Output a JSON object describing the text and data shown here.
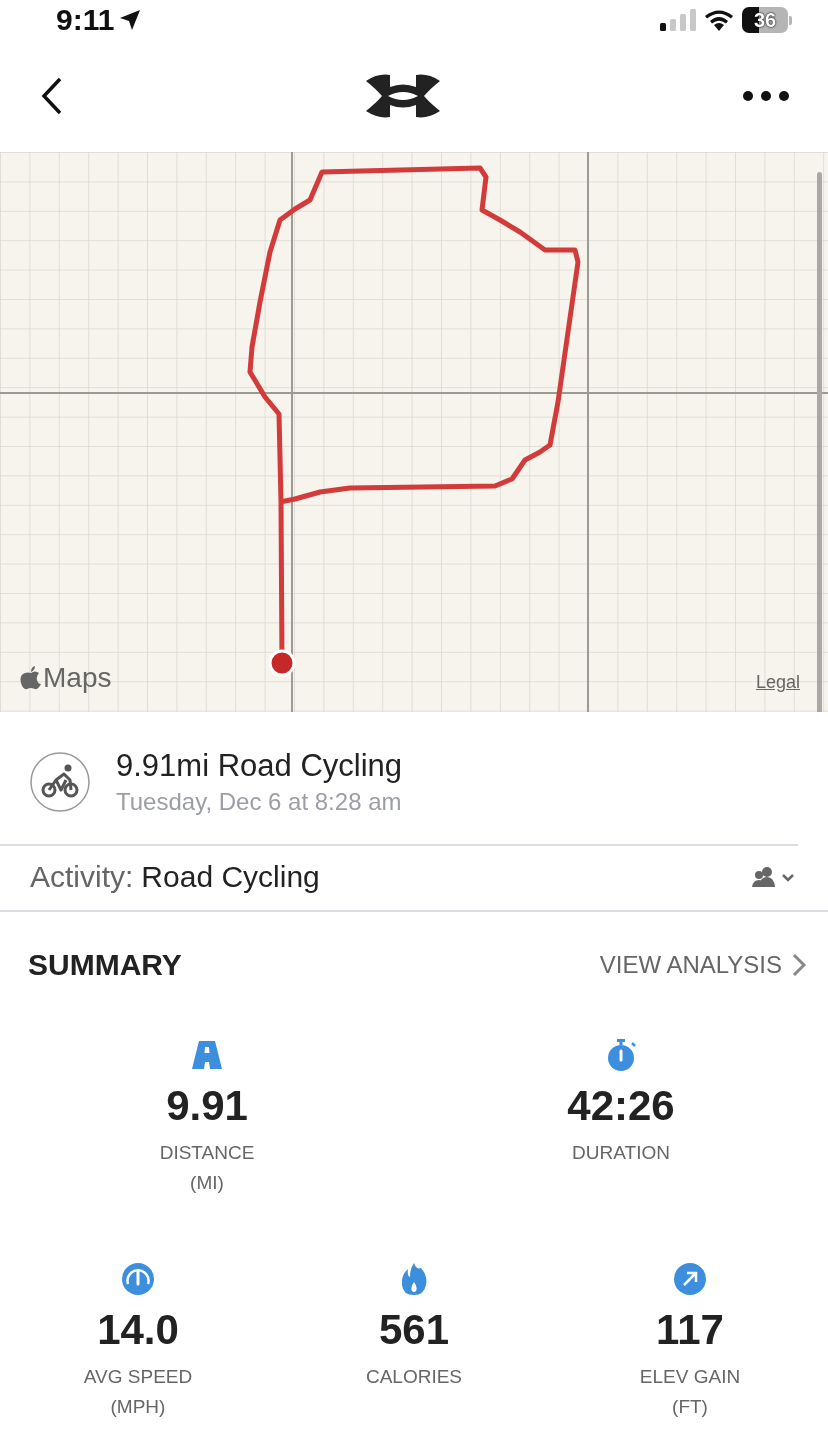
{
  "status_bar": {
    "time": "9:11",
    "battery": "36"
  },
  "map": {
    "kind": "picture",
    "brand": "Maps",
    "legal": "Legal"
  },
  "workout": {
    "title": "9.91mi Road Cycling",
    "date": "Tuesday, Dec 6 at 8:28 am"
  },
  "activity": {
    "label": "Activity:",
    "value": "Road Cycling"
  },
  "summary": {
    "title": "SUMMARY",
    "link": "VIEW ANALYSIS"
  },
  "stat_rows": [
    [
      {
        "kind": "distance",
        "value": "9.91",
        "label": "DISTANCE",
        "unit": "(MI)"
      },
      {
        "kind": "duration",
        "value": "42:26",
        "label": "DURATION"
      }
    ],
    [
      {
        "kind": "speed",
        "value": "14.0",
        "label": "AVG SPEED",
        "unit": "(MPH)"
      },
      {
        "kind": "calories",
        "value": "561",
        "label": "CALORIES"
      },
      {
        "kind": "elevation",
        "value": "117",
        "label": "ELEV GAIN",
        "unit": "(FT)"
      }
    ]
  ]
}
